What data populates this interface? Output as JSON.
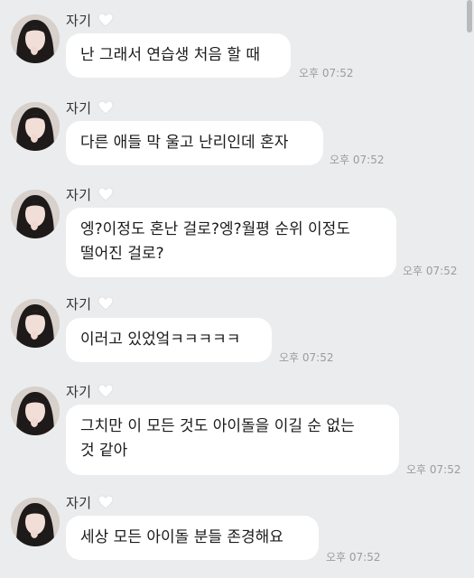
{
  "messages": [
    {
      "sender": "자기",
      "text": "난 그래서 연습생 처음 할 때",
      "time": "오후 07:52"
    },
    {
      "sender": "자기",
      "text": "다른 애들 막 울고 난리인데 혼자",
      "time": "오후 07:52"
    },
    {
      "sender": "자기",
      "text": "엥?이정도 혼난 걸로?엥?월평 순위 이정도\n떨어진 걸로?",
      "time": "오후 07:52"
    },
    {
      "sender": "자기",
      "text": "이러고 있었엌ㅋㅋㅋㅋㅋ",
      "time": "오후 07:52"
    },
    {
      "sender": "자기",
      "text": "그치만 이 모든 것도 아이돌을 이길 순 없는\n것 같아",
      "time": "오후 07:52"
    },
    {
      "sender": "자기",
      "text": "세상 모든 아이돌 분들 존경해요",
      "time": "오후 07:52"
    }
  ],
  "icons": {
    "heart": "white-heart-icon",
    "avatar": "profile-avatar"
  },
  "colors": {
    "background": "#ebeced",
    "bubble": "#ffffff",
    "time_text": "#9b9c9e"
  }
}
